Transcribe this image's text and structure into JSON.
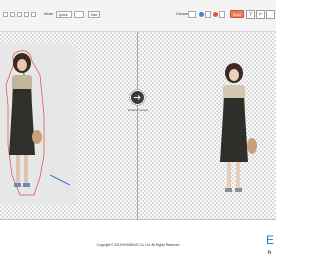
{
  "toolbar": {
    "mode_label": "Mode:",
    "mode_value": "Quick",
    "size_label": "Size",
    "canvas_label": "Canvas:",
    "done_label": "Done",
    "help_label": "?",
    "undo_label": "↶"
  },
  "workspace": {
    "process_caption": "Refresh Cutout"
  },
  "footer": {
    "copyright": "Copyright © 2019 EHUNKNIT Co. Ltd. All Rights Reserved",
    "brand_letter": "E",
    "brand_sub": "h"
  },
  "colors": {
    "accent": "#f07b5b",
    "brand": "#1f7ac8"
  }
}
